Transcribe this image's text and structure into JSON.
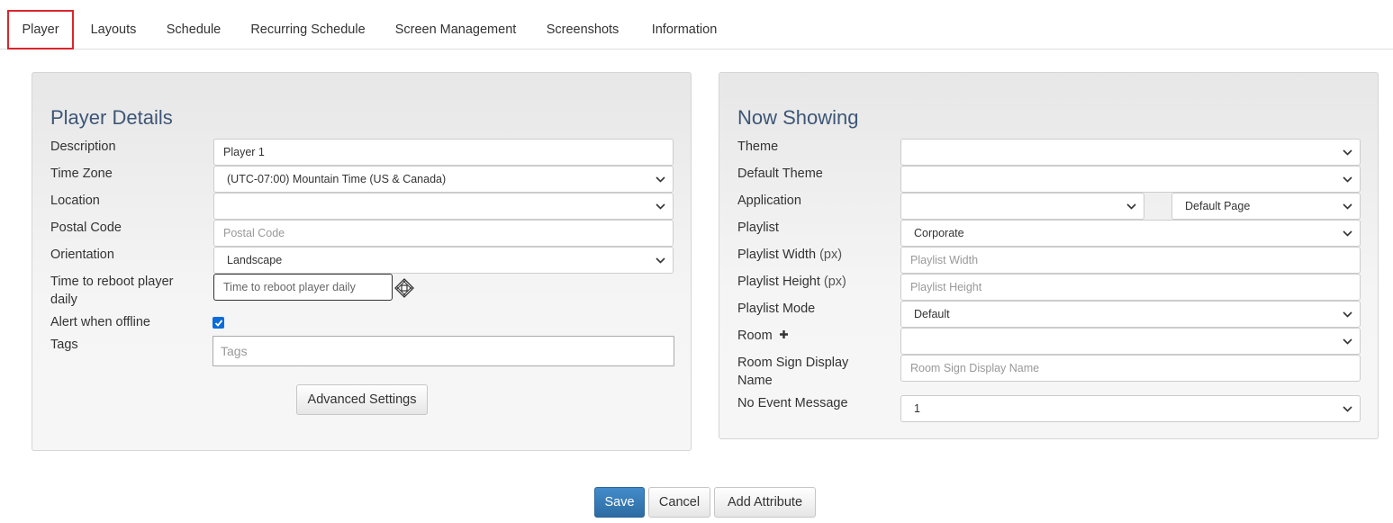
{
  "tabs": [
    {
      "label": "Player"
    },
    {
      "label": "Layouts"
    },
    {
      "label": "Schedule"
    },
    {
      "label": "Recurring Schedule"
    },
    {
      "label": "Screen Management"
    },
    {
      "label": "Screenshots"
    },
    {
      "label": "Information"
    }
  ],
  "player_details": {
    "title": "Player Details",
    "description": {
      "label": "Description",
      "value": "Player 1"
    },
    "time_zone": {
      "label": "Time Zone",
      "value": "(UTC-07:00) Mountain Time (US & Canada)"
    },
    "location": {
      "label": "Location",
      "value": ""
    },
    "postal_code": {
      "label": "Postal Code",
      "placeholder": "Postal Code"
    },
    "orientation": {
      "label": "Orientation",
      "value": "Landscape"
    },
    "reboot": {
      "label_line1": "Time to reboot player",
      "label_line2": "daily",
      "placeholder": "Time to reboot player daily",
      "icon": "clock-picker-icon"
    },
    "alert_offline": {
      "label": "Alert when offline",
      "checked": true
    },
    "tags": {
      "label": "Tags",
      "placeholder": "Tags"
    },
    "advanced_settings_label": "Advanced Settings"
  },
  "now_showing": {
    "title": "Now Showing",
    "theme": {
      "label": "Theme",
      "value": ""
    },
    "default_theme": {
      "label": "Default Theme",
      "value": ""
    },
    "application": {
      "label": "Application",
      "value": "",
      "page_value": "Default Page"
    },
    "playlist": {
      "label": "Playlist",
      "value": "Corporate"
    },
    "playlist_width": {
      "label": "Playlist Width",
      "unit": "(px)",
      "placeholder": "Playlist Width"
    },
    "playlist_height": {
      "label": "Playlist Height",
      "unit": "(px)",
      "placeholder": "Playlist Height"
    },
    "playlist_mode": {
      "label": "Playlist Mode",
      "value": "Default"
    },
    "room": {
      "label": "Room",
      "value": "",
      "add_icon": "plus-icon"
    },
    "room_sign": {
      "label_line1": "Room Sign Display",
      "label_line2": "Name",
      "placeholder": "Room Sign Display Name"
    },
    "no_event": {
      "label": "No Event Message",
      "value": "1"
    }
  },
  "footer": {
    "save_label": "Save",
    "cancel_label": "Cancel",
    "add_attribute_label": "Add Attribute"
  }
}
